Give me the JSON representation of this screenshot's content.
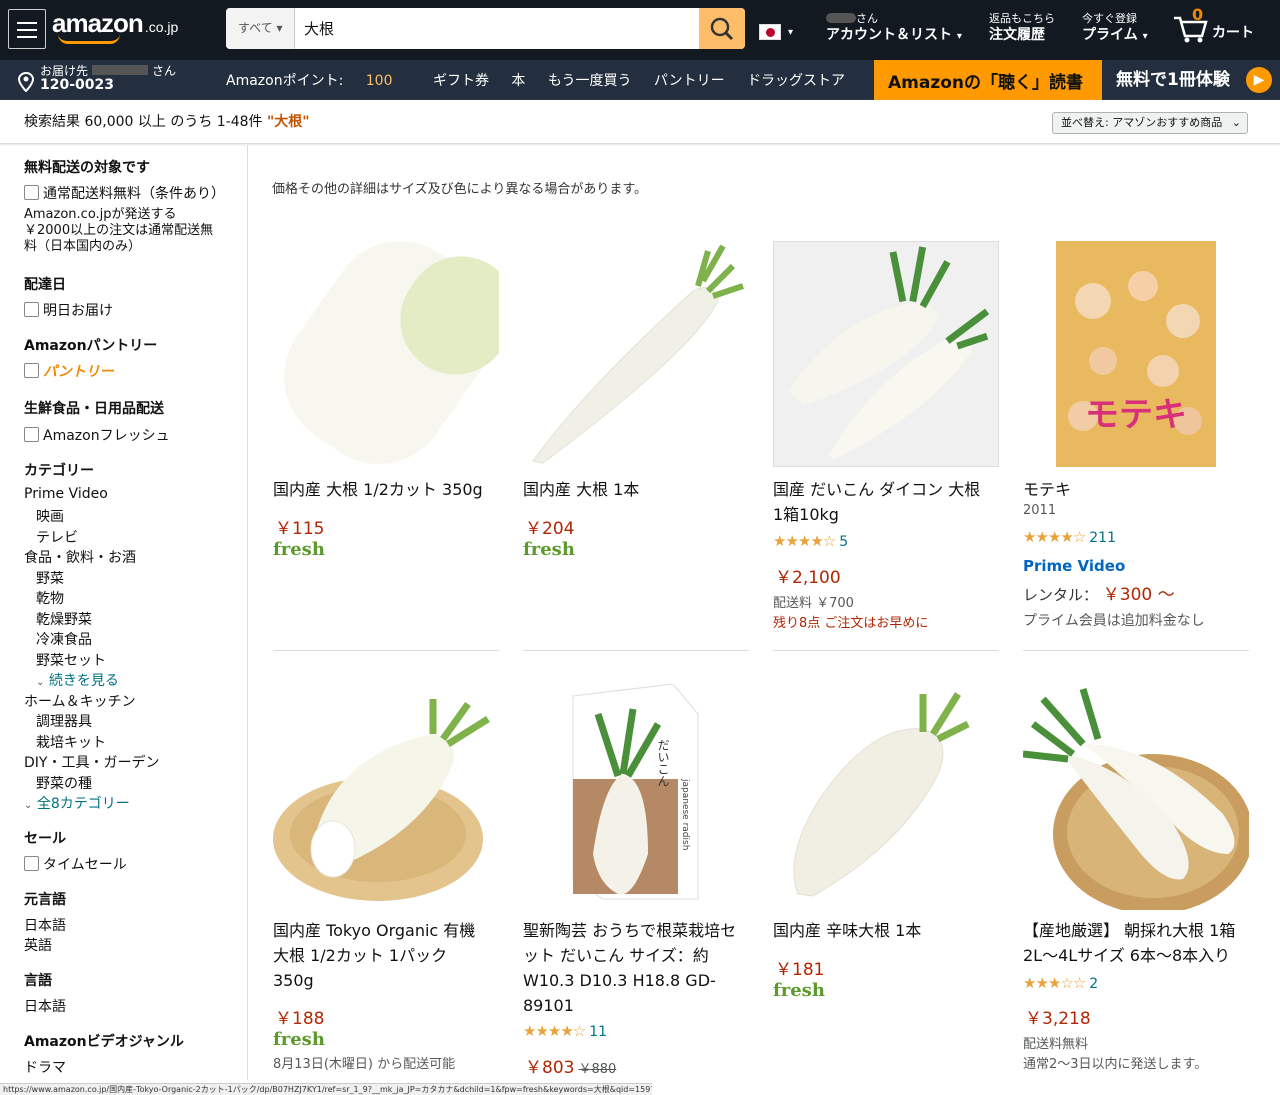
{
  "header": {
    "logo": "amazon",
    "logo_domain": ".co.jp",
    "search_category": "すべて",
    "search_value": "大根",
    "account_greeting": "さん",
    "account_label": "アカウント＆リスト",
    "orders_top": "返品もこちら",
    "orders_label": "注文履歴",
    "prime_top": "今すぐ登録",
    "prime_label": "プライム",
    "cart_count": "0",
    "cart_label": "カート"
  },
  "subnav": {
    "deliver_top": "お届け先",
    "deliver_suffix": "さん",
    "zip": "120-0023",
    "points_label": "Amazonポイント:",
    "points_value": "100",
    "links": [
      "ギフト券",
      "本",
      "もう一度買う",
      "パントリー",
      "ドラッグストア"
    ],
    "promo_left": "Amazonの「聴く」読書",
    "promo_right": "無料で1冊体験"
  },
  "results": {
    "summary": "検索結果 60,000 以上 のうち 1-48件",
    "query": "\"大根\"",
    "sort_label": "並べ替え: アマゾンおすすめ商品"
  },
  "sidebar": {
    "free_ship_heading": "無料配送の対象です",
    "free_ship_option": "通常配送料無料（条件あり）",
    "free_ship_note_1": "Amazon.co.jpが発送する",
    "free_ship_note_2": "￥2000以上の注文は通常配送無",
    "free_ship_note_3": "料（日本国内のみ）",
    "delivery_heading": "配達日",
    "delivery_option": "明日お届け",
    "pantry_heading": "Amazonパントリー",
    "pantry_option": "パントリー",
    "fresh_heading": "生鮮食品・日用品配送",
    "fresh_option": "Amazonフレッシュ",
    "category_heading": "カテゴリー",
    "cat_prime": "Prime Video",
    "cat_movie": "映画",
    "cat_tv": "テレビ",
    "cat_food": "食品・飲料・お酒",
    "cat_veg": "野菜",
    "cat_dried": "乾物",
    "cat_dried_veg": "乾燥野菜",
    "cat_frozen": "冷凍食品",
    "cat_veg_set": "野菜セット",
    "cat_more": "続きを見る",
    "cat_home": "ホーム＆キッチン",
    "cat_cook": "調理器具",
    "cat_grow": "栽培キット",
    "cat_diy": "DIY・工具・ガーデン",
    "cat_seeds": "野菜の種",
    "cat_all": "全8カテゴリー",
    "sale_heading": "セール",
    "sale_option": "タイムセール",
    "orig_lang_heading": "元言語",
    "orig_lang_1": "日本語",
    "orig_lang_2": "英語",
    "lang_heading": "言語",
    "lang_1": "日本語",
    "video_genre_heading": "Amazonビデオジャンル",
    "genre_1": "ドラマ"
  },
  "note": "価格その他の詳細はサイズ及び色により異なる場合があります。",
  "products": [
    {
      "title": "国内産 大根 1/2カット 350g",
      "price": "￥115",
      "badge": "fresh"
    },
    {
      "title": "国内産 大根 1本",
      "price": "￥204",
      "badge": "fresh"
    },
    {
      "title_1": "国産 だいこん ダイコン 大根",
      "title_2": "1箱10kg",
      "rating": 3.5,
      "reviews": "5",
      "price": "￥2,100",
      "shipping": "配送料 ￥700",
      "stock": "残り8点 ご注文はお早めに"
    },
    {
      "title": "モテキ",
      "year": "2011",
      "rating": 3.5,
      "reviews": "211",
      "prime": "Prime Video",
      "rental": "レンタル：",
      "price": "￥300 〜",
      "note": "プライム会員は追加料金なし",
      "poster_text": "モテキ"
    },
    {
      "title_1": "国内産 Tokyo Organic 有機",
      "title_2": "大根 1/2カット 1パック",
      "title_3": "350g",
      "price": "￥188",
      "badge": "fresh",
      "delivery": "8月13日(木曜日) から配送可能"
    },
    {
      "title_1": "聖新陶芸 おうちで根菜栽培セ",
      "title_2": "ット だいこん サイズ：約",
      "title_3": "W10.3 D10.3 H18.8 GD-",
      "title_4": "89101",
      "rating": 3.5,
      "reviews": "11",
      "price": "￥803",
      "old_price": "￥880",
      "box_text_1": "だいこん",
      "box_text_2": "japanese radish"
    },
    {
      "title": "国内産 辛味大根 1本",
      "price": "￥181",
      "badge": "fresh"
    },
    {
      "title_1": "【産地厳選】 朝採れ大根 1箱",
      "title_2": "2L～4Lサイズ 6本～8本入り",
      "rating": 3,
      "reviews": "2",
      "price": "￥3,218",
      "shipping": "配送料無料",
      "ship_time": "通常2～3日以内に発送します。"
    }
  ],
  "stars": {
    "s3": "★★★☆☆",
    "s35": "★★★★☆"
  },
  "statusbar": "https://www.amazon.co.jp/国内産-Tokyo-Organic-2カット-1パック/dp/B07HZJ7KY1/ref=sr_1_9?__mk_ja_JP=カタカナ&dchild=1&fpw=fresh&keywords=大根&qid=1597130678&sr=8-9",
  "colors": {
    "nav": "#131921",
    "subnav": "#232f3e",
    "accent": "#ff9900",
    "price": "#b12704",
    "link": "#007185"
  }
}
